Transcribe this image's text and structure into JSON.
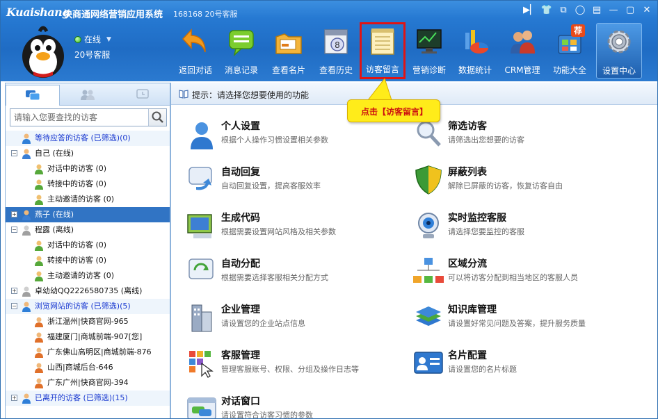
{
  "titlebar": {
    "logo": "Kuaishang",
    "app_name": "快商通网络营销应用系统",
    "user_id": "168168 20号客服"
  },
  "profile": {
    "status": "在线",
    "name": "20号客服"
  },
  "toolbar": {
    "items": [
      {
        "label": "返回对话",
        "icon": "back-arrow-icon"
      },
      {
        "label": "消息记录",
        "icon": "message-record-icon"
      },
      {
        "label": "查看名片",
        "icon": "business-card-icon"
      },
      {
        "label": "查看历史",
        "icon": "history-icon"
      },
      {
        "label": "访客留言",
        "icon": "notepad-icon"
      },
      {
        "label": "营销诊断",
        "icon": "diagnosis-icon"
      },
      {
        "label": "数据统计",
        "icon": "statistics-icon"
      },
      {
        "label": "CRM管理",
        "icon": "crm-icon"
      },
      {
        "label": "功能大全",
        "icon": "functions-icon",
        "badge": "荐"
      },
      {
        "label": "设置中心",
        "icon": "gear-icon"
      }
    ],
    "active_index": 4
  },
  "sidebar": {
    "search_placeholder": "请输入您要查找的访客",
    "tree": [
      {
        "text": "等待应答的访客 (已筛选)(0)",
        "level": 0,
        "type": "group-blue",
        "toggle": ""
      },
      {
        "text": "自己 (在线)",
        "level": 0,
        "type": "person",
        "toggle": "−"
      },
      {
        "text": "对话中的访客 (0)",
        "level": 1,
        "type": "sub"
      },
      {
        "text": "转接中的访客 (0)",
        "level": 1,
        "type": "sub"
      },
      {
        "text": "主动邀请的访客 (0)",
        "level": 1,
        "type": "sub"
      },
      {
        "text": "燕子 (在线)",
        "level": 0,
        "type": "person-selected",
        "toggle": "+"
      },
      {
        "text": "程露 (离线)",
        "level": 0,
        "type": "person-offline",
        "toggle": "−"
      },
      {
        "text": "对话中的访客 (0)",
        "level": 1,
        "type": "sub"
      },
      {
        "text": "转接中的访客 (0)",
        "level": 1,
        "type": "sub"
      },
      {
        "text": "主动邀请的访客 (0)",
        "level": 1,
        "type": "sub"
      },
      {
        "text": "卓幼幼QQ2226580735 (离线)",
        "level": 0,
        "type": "person-offline",
        "toggle": "+"
      },
      {
        "text": "浏览网站的访客 (已筛选)(5)",
        "level": 0,
        "type": "group-blue",
        "toggle": "−"
      },
      {
        "text": "浙江温州|快商官网-965",
        "level": 1,
        "type": "visitor"
      },
      {
        "text": "福建厦门|商城前端-907[您]",
        "level": 1,
        "type": "visitor"
      },
      {
        "text": "广东佛山高明区|商城前端-876",
        "level": 1,
        "type": "visitor"
      },
      {
        "text": "山西|商城后台-646",
        "level": 1,
        "type": "visitor"
      },
      {
        "text": "广东广州|快商官网-394",
        "level": 1,
        "type": "visitor"
      },
      {
        "text": "已离开的访客 (已筛选)(15)",
        "level": 0,
        "type": "group-blue",
        "toggle": "+"
      }
    ]
  },
  "main": {
    "tip": "提示：请选择您想要使用的功能",
    "features": [
      {
        "title": "个人设置",
        "desc": "根据个人操作习惯设置相关参数",
        "icon": "person-icon"
      },
      {
        "title": "筛选访客",
        "desc": "请筛选出您想要的访客",
        "icon": "magnifier-icon"
      },
      {
        "title": "自动回复",
        "desc": "自动回复设置，提高客服效率",
        "icon": "auto-reply-icon"
      },
      {
        "title": "屏蔽列表",
        "desc": "解除已屏蔽的访客，恢复访客自由",
        "icon": "shield-icon"
      },
      {
        "title": "生成代码",
        "desc": "根据需要设置网站风格及相关参数",
        "icon": "code-monitor-icon"
      },
      {
        "title": "实时监控客服",
        "desc": "请选择您要监控的客服",
        "icon": "webcam-icon"
      },
      {
        "title": "自动分配",
        "desc": "根据需要选择客服相关分配方式",
        "icon": "auto-assign-icon"
      },
      {
        "title": "区域分流",
        "desc": "可以将访客分配到相当地区的客服人员",
        "icon": "network-icon"
      },
      {
        "title": "企业管理",
        "desc": "请设置您的企业站点信息",
        "icon": "building-icon"
      },
      {
        "title": "知识库管理",
        "desc": "请设置好常见问题及答案，提升服务质量",
        "icon": "books-icon"
      },
      {
        "title": "客服管理",
        "desc": "管理客服账号、权限、分组及操作日志等",
        "icon": "grid-cursor-icon"
      },
      {
        "title": "名片配置",
        "desc": "请设置您的名片标题",
        "icon": "id-card-icon"
      },
      {
        "title": "对话窗口",
        "desc": "请设置符合访客习惯的参数",
        "icon": "chat-window-icon"
      }
    ]
  },
  "callout": {
    "text": "点击【访客留言】"
  }
}
